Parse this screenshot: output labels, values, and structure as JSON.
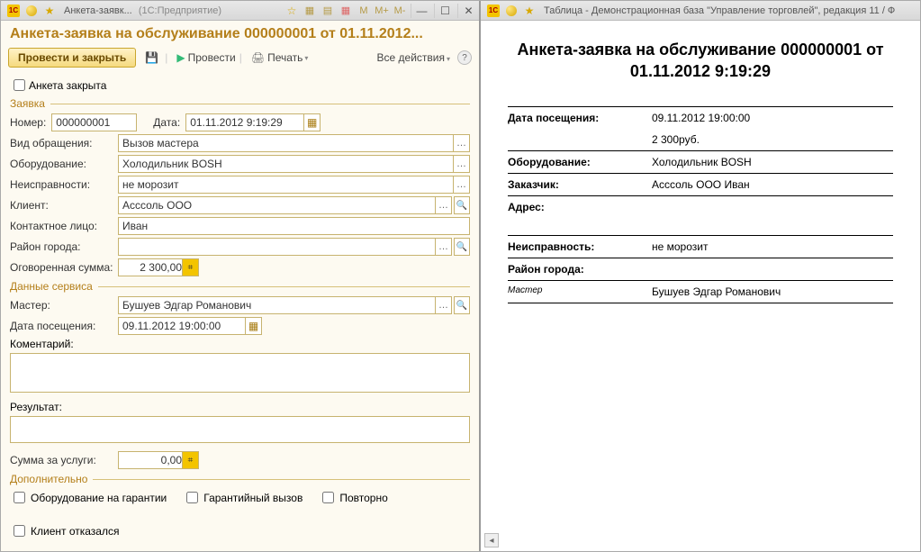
{
  "left": {
    "titlebar": {
      "tab": "Анкета-заявк...",
      "suffix": "(1С:Предприятие)",
      "tools": [
        "M",
        "M+",
        "M-"
      ]
    },
    "title": "Анкета-заявка на обслуживание 000000001 от 01.11.2012...",
    "toolbar": {
      "commit_close": "Провести и закрыть",
      "commit": "Провести",
      "print": "Печать",
      "all_actions": "Все действия"
    },
    "closed_chk": "Анкета закрыта",
    "group_request": "Заявка",
    "fields": {
      "number_label": "Номер:",
      "number_value": "000000001",
      "date_label": "Дата:",
      "date_value": "01.11.2012  9:19:29",
      "appeal_label": "Вид обращения:",
      "appeal_value": "Вызов мастера",
      "equipment_label": "Оборудование:",
      "equipment_value": "Холодильник BOSH",
      "faults_label": "Неисправности:",
      "faults_value": "не морозит",
      "client_label": "Клиент:",
      "client_value": "Асссоль ООО",
      "contact_label": "Контактное лицо:",
      "contact_value": "Иван",
      "district_label": "Район города:",
      "district_value": "",
      "agreed_sum_label": "Оговоренная сумма:",
      "agreed_sum_value": "2 300,00"
    },
    "group_service": "Данные сервиса",
    "service": {
      "master_label": "Мастер:",
      "master_value": "Бушуев Эдгар Романович",
      "visit_label": "Дата посещения:",
      "visit_value": "09.11.2012 19:00:00",
      "comment_label": "Коментарий:",
      "comment_value": "",
      "result_label": "Результат:",
      "result_value": "",
      "service_sum_label": "Сумма за услуги:",
      "service_sum_value": "0,00"
    },
    "group_extra": "Дополнительно",
    "extra": {
      "warranty": "Оборудование на гарантии",
      "warranty_call": "Гарантийный вызов",
      "repeat": "Повторно",
      "refused": "Клиент отказался"
    }
  },
  "right": {
    "titlebar": "Таблица - Демонстрационная база \"Управление торговлей\", редакция 11 / Ф",
    "title": "Анкета-заявка на обслуживание 000000001 от 01.11.2012 9:19:29",
    "rows": {
      "visit_label": "Дата посещения:",
      "visit_value": "09.11.2012 19:00:00",
      "price_value": "2 300руб.",
      "equipment_label": "Оборудование:",
      "equipment_value": "Холодильник BOSH",
      "customer_label": "Заказчик:",
      "customer_value": "Асссоль ООО Иван",
      "address_label": "Адрес:",
      "address_value": "",
      "fault_label": "Неисправность:",
      "fault_value": "не морозит",
      "district_label": "Район города:",
      "district_value": "",
      "master_em": "Мастер",
      "master_value": "Бушуев Эдгар Романович"
    }
  }
}
